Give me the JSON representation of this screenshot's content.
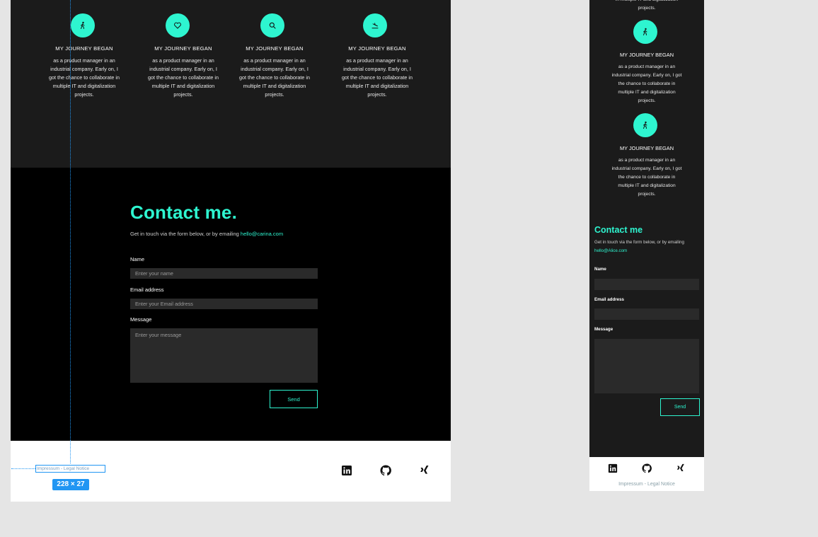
{
  "colors": {
    "accent": "#2ef5d0",
    "dark": "#1b1b1b",
    "black": "#000000",
    "selection": "#2196f3"
  },
  "desktop": {
    "journey": [
      {
        "icon": "person-walking-icon",
        "title": "MY JOURNEY BEGAN",
        "desc": "as a product manager in an industrial company. Early on, I got the chance to collaborate in multiple IT and digitalization projects."
      },
      {
        "icon": "heart-icon",
        "title": "MY JOURNEY BEGAN",
        "desc": "as a product manager in an industrial company. Early on, I got the chance to collaborate in multiple IT and digitalization projects."
      },
      {
        "icon": "search-icon",
        "title": "MY JOURNEY BEGAN",
        "desc": "as a product manager in an industrial company. Early on, I got the chance to collaborate in multiple IT and digitalization projects."
      },
      {
        "icon": "plane-landing-icon",
        "title": "MY JOURNEY BEGAN",
        "desc": "as a product manager in an industrial company. Early on, I got the chance to collaborate in multiple IT and digitalization projects."
      }
    ],
    "contact": {
      "title": "Contact me.",
      "subtitle": "Get in touch via the form below, or by emailing ",
      "email": "hello@carina.com",
      "name_label": "Name",
      "name_placeholder": "Enter your name",
      "email_label": "Email address",
      "email_placeholder": "Enter your Email address",
      "message_label": "Message",
      "message_placeholder": "Enter your message",
      "send_label": "Send"
    },
    "footer": {
      "legal": "Impressum - Legal Notice",
      "size_badge": "228 × 27",
      "socials": [
        "linkedin-icon",
        "github-icon",
        "xing-icon"
      ]
    }
  },
  "mobile": {
    "journey_top_text": "in multiple IT and digitalization projects.",
    "journey": [
      {
        "icon": "person-walking-icon",
        "title": "MY JOURNEY BEGAN",
        "desc": "as a product manager in an industrial company. Early on, I got the chance to collaborate in multiple IT and digitalization projects."
      },
      {
        "icon": "person-walking-icon",
        "title": "MY JOURNEY BEGAN",
        "desc": "as a product manager in an industrial company. Early on, I got the chance to collaborate in multiple IT and digitalization projects."
      }
    ],
    "contact": {
      "title": "Contact me",
      "subtitle": "Get in touch via the form below, or by emailing",
      "email": "hello@Alice.com",
      "name_label": "Name",
      "email_label": "Email address",
      "message_label": "Message",
      "send_label": "Send"
    },
    "footer": {
      "legal": "Impressum - Legal Notice"
    }
  }
}
